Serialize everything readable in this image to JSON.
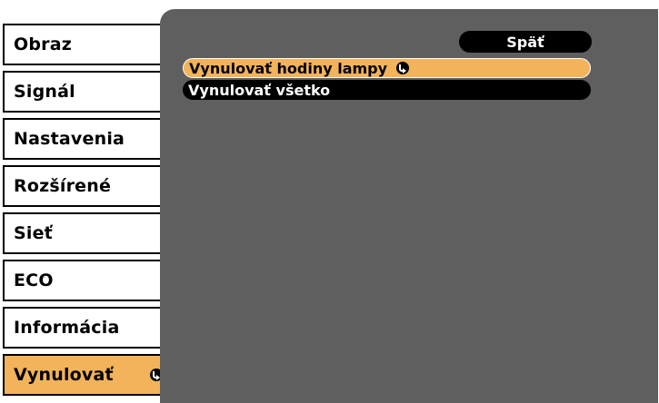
{
  "sidebar": {
    "items": [
      {
        "label": "Obraz"
      },
      {
        "label": "Signál"
      },
      {
        "label": "Nastavenia"
      },
      {
        "label": "Rozšírené"
      },
      {
        "label": "Sieť"
      },
      {
        "label": "ECO"
      },
      {
        "label": "Informácia"
      },
      {
        "label": "Vynulovať",
        "active": true,
        "icon": "enter-icon"
      }
    ]
  },
  "panel": {
    "back_label": "Späť",
    "options": [
      {
        "label": "Vynulovať hodiny lampy",
        "selected": true,
        "icon": "enter-icon"
      },
      {
        "label": "Vynulovať všetko",
        "selected": false
      }
    ]
  },
  "colors": {
    "highlight": "#f2b35a",
    "panel_bg": "#5f5f5f",
    "item_bg": "#ffffff",
    "dark": "#000000"
  }
}
